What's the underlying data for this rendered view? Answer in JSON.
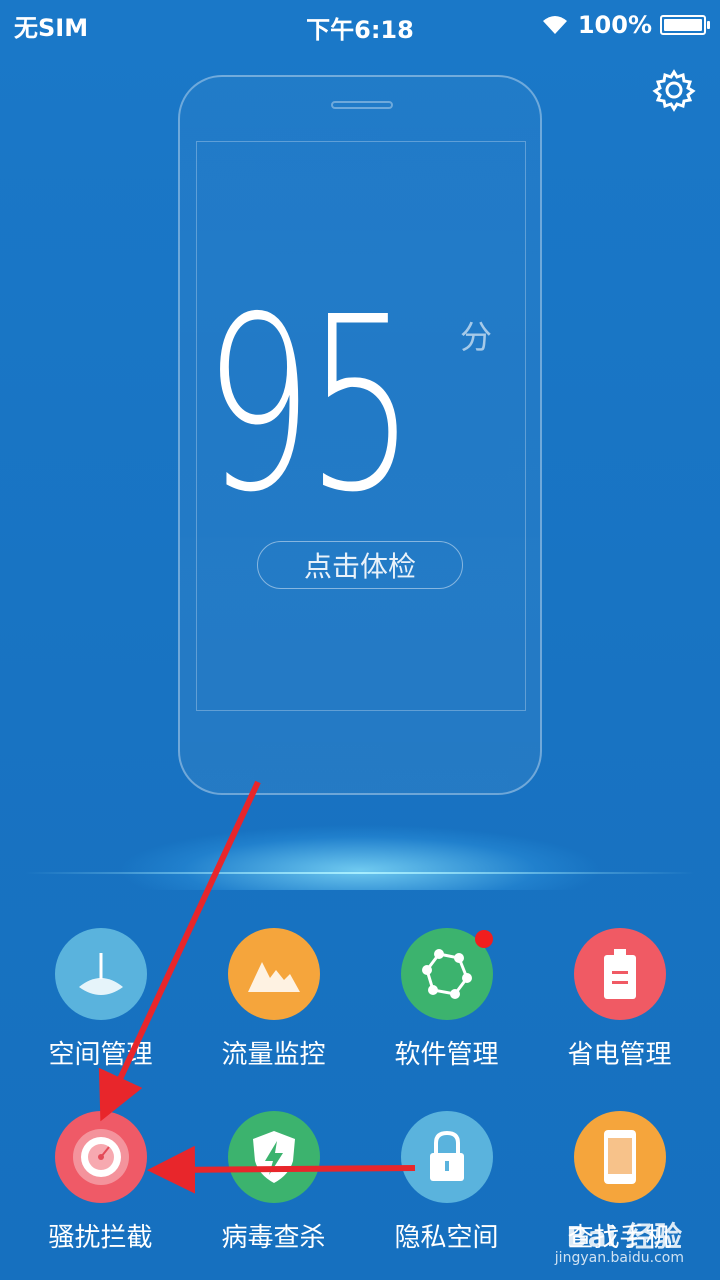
{
  "status_bar": {
    "carrier": "无SIM",
    "time": "下午6:18",
    "battery_text": "100%",
    "battery_level": 1.0
  },
  "score": {
    "value": "95",
    "unit": "分",
    "action_label": "点击体检"
  },
  "features": [
    {
      "label": "空间管理",
      "icon": "pie-sector-icon",
      "color": "#5ab3dd"
    },
    {
      "label": "流量监控",
      "icon": "mountain-chart-icon",
      "color": "#f5a53c"
    },
    {
      "label": "软件管理",
      "icon": "hexagon-network-icon",
      "color": "#3cb36e",
      "badge": true
    },
    {
      "label": "省电管理",
      "icon": "battery-icon",
      "color": "#f05a64"
    },
    {
      "label": "骚扰拦截",
      "icon": "target-icon",
      "color": "#ef5a67"
    },
    {
      "label": "病毒查杀",
      "icon": "shield-bolt-icon",
      "color": "#3cb36e"
    },
    {
      "label": "隐私空间",
      "icon": "padlock-icon",
      "color": "#5ab3dd"
    },
    {
      "label": "查找手机",
      "icon": "phone-icon",
      "color": "#f5a53c"
    }
  ],
  "watermark": {
    "text": "Bai 经验",
    "sub": "jingyan.baidu.com"
  },
  "colors": {
    "background": "#1873c2",
    "arrow": "#e8262b"
  }
}
